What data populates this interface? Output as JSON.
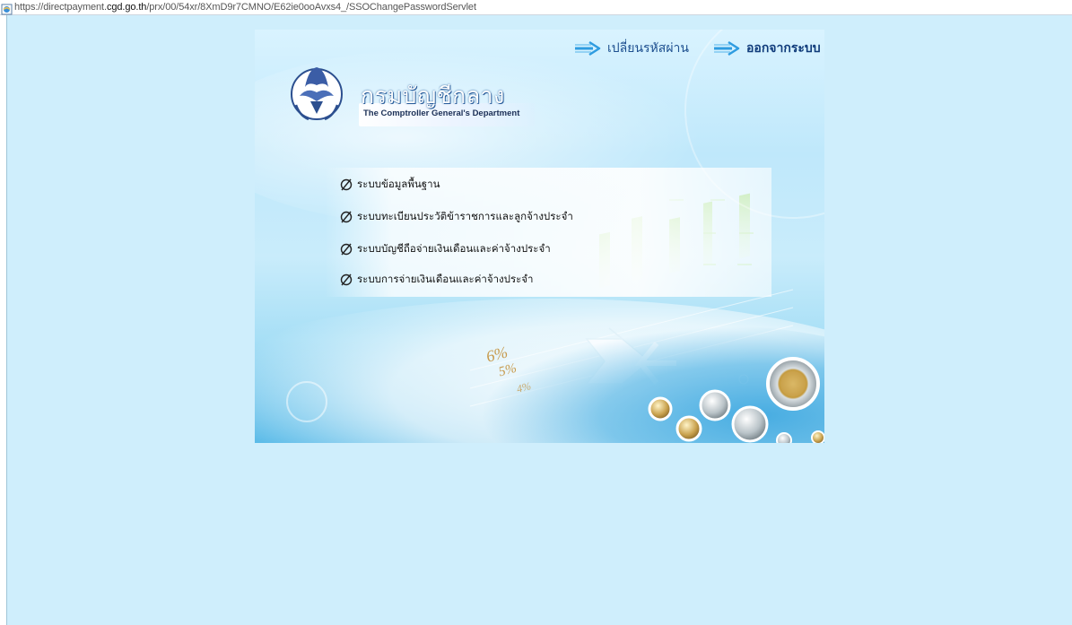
{
  "browser": {
    "url_prefix": "https://directpayment.",
    "url_host": "cgd.go.th",
    "url_path": "/prx/00/54xr/8XmD9r7CMNO/E62ie0ooAvxs4_/SSOChangePasswordServlet"
  },
  "header": {
    "change_password": "เปลี่ยนรหัสผ่าน",
    "logout": "ออกจากระบบ"
  },
  "logo": {
    "title_th": "กรมบัญชีกลาง",
    "subtitle_en": "The Comptroller General's Department",
    "seal_text": "กรมบัญชีกลาง"
  },
  "menu": {
    "items": [
      {
        "label": "ระบบข้อมูลพื้นฐาน"
      },
      {
        "label": "ระบบทะเบียนประวัติข้าราชการและลูกจ้างประจำ"
      },
      {
        "label": "ระบบบัญชีถือจ่ายเงินเดือนและค่าจ้างประจำ"
      },
      {
        "label": "ระบบการจ่ายเงินเดือนและค่าจ้างประจำ"
      }
    ]
  },
  "decor": {
    "percent_labels": [
      "6%",
      "5%",
      "4%"
    ]
  },
  "colors": {
    "page_bg": "#cfeefc",
    "link": "#1d4f8f",
    "title_shadow": "#2a5e9c"
  }
}
